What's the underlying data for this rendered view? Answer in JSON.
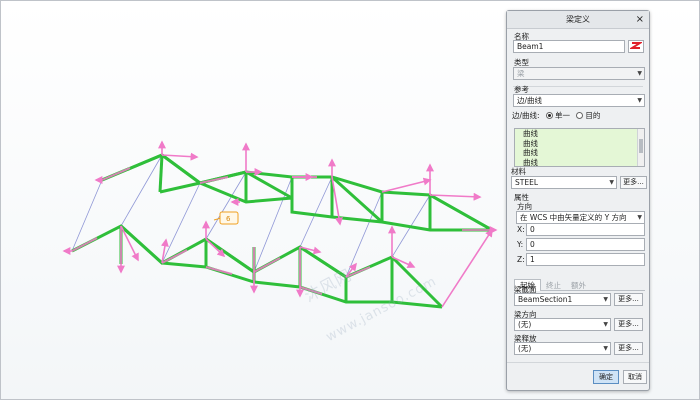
{
  "dialog": {
    "title": "梁定义",
    "close_label": "×",
    "name_label": "名称",
    "name_value": "Beam1",
    "type_label": "类型",
    "type_value": "梁",
    "reference_label": "参考",
    "reference_value": "边/曲线",
    "edge_curve_label": "边/曲线:",
    "radio_single": "单一",
    "radio_target": "目的",
    "curve_items": [
      "曲线",
      "曲线",
      "曲线",
      "曲线"
    ],
    "material_label": "材料",
    "material_value": "STEEL",
    "more_label": "更多...",
    "properties_label": "属性",
    "direction_label": "方向",
    "direction_value": "在 WCS 中由矢量定义的 Y 方向",
    "x_label": "X:",
    "x_value": "0",
    "y_label": "Y:",
    "y_value": "0",
    "z_label": "Z:",
    "z_value": "1",
    "tabs": [
      "起始",
      "终止",
      "额外"
    ],
    "section_label": "梁截面",
    "section_value": "BeamSection1",
    "orientation_label": "梁方向",
    "orientation_value": "(无)",
    "release_label": "梁释放",
    "release_value": "(无)",
    "ok_label": "确定",
    "cancel_label": "取消"
  },
  "viewport": {
    "marker_label": "6",
    "watermark_line1": "沐风网",
    "watermark_line2": "www.jansoo.com"
  },
  "colors": {
    "beam_green": "#2fbf3a",
    "beam_pink": "#f07ac8",
    "guide_blue": "#8f97d6",
    "marker_orange": "#f0a020",
    "list_green": "#e4f7d6",
    "ok_blue": "#cfe3f6"
  }
}
